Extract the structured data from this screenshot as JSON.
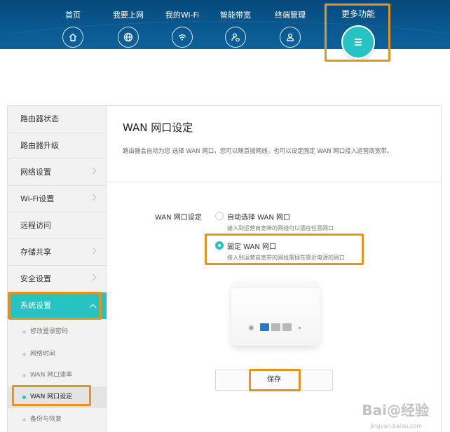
{
  "nav": {
    "items": [
      {
        "label": "首页",
        "icon": "home-icon"
      },
      {
        "label": "我要上网",
        "icon": "globe-icon"
      },
      {
        "label": "我的Wi-Fi",
        "icon": "wifi-icon"
      },
      {
        "label": "智能带宽",
        "icon": "bandwidth-icon"
      },
      {
        "label": "终端管理",
        "icon": "user-icon"
      }
    ],
    "more": {
      "label": "更多功能",
      "icon": "menu-icon"
    }
  },
  "sidebar": {
    "items": [
      {
        "label": "路由器状态"
      },
      {
        "label": "路由器升级"
      },
      {
        "label": "网络设置"
      },
      {
        "label": "Wi-Fi设置"
      },
      {
        "label": "远程访问"
      },
      {
        "label": "存储共享"
      },
      {
        "label": "安全设置"
      },
      {
        "label": "系统设置"
      }
    ],
    "sub_items": [
      {
        "label": "修改登录密码"
      },
      {
        "label": "网络时间"
      },
      {
        "label": "WAN 网口速率"
      },
      {
        "label": "WAN 网口设定"
      },
      {
        "label": "备份与恢复"
      }
    ]
  },
  "panel": {
    "title": "WAN 网口设定",
    "description": "路由器会自动为您 选择 WAN 网口，您可以随意插网线，也可以设定固定 WAN 网口接入运营商宽带。",
    "field_label": "WAN 网口设定",
    "options": [
      {
        "title": "自动选择 WAN 网口",
        "subtitle": "接入到运营商宽带的网线可以插在任意网口",
        "checked": false
      },
      {
        "title": "固定 WAN 网口",
        "subtitle": "接入到运营商宽带的网线需插在靠近电源的网口",
        "checked": true
      }
    ],
    "save_label": "保存"
  },
  "watermark": {
    "brand": "Bai@经验",
    "url": "jingyan.baidu.com"
  },
  "colors": {
    "accent": "#27c2c2",
    "highlight": "#e8941a",
    "header": "#0a5a92",
    "port_blue": "#1a7fd1",
    "port_gray": "#b8b8b8"
  }
}
